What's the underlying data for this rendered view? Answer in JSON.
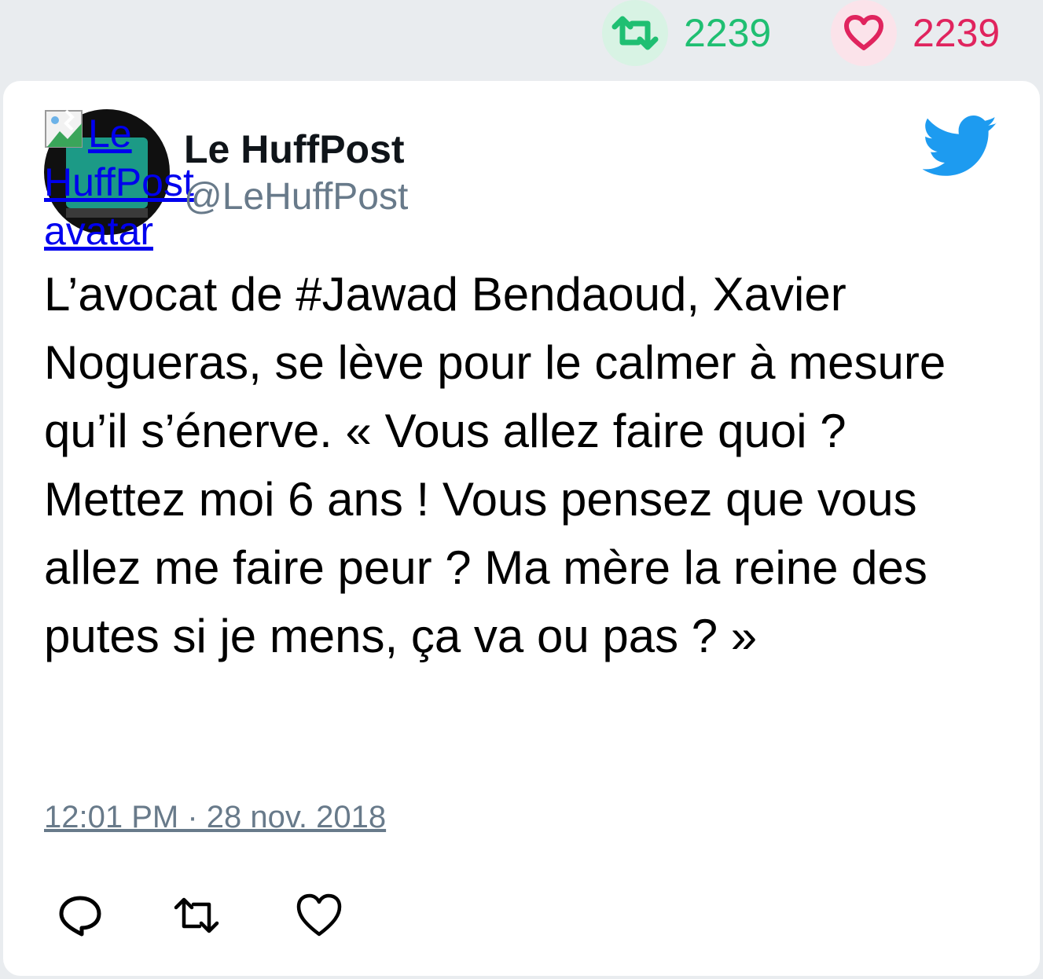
{
  "stats": {
    "retweet_count": "2239",
    "like_count": "2239"
  },
  "tweet": {
    "avatar_alt": "Le HuffPost avatar",
    "author_name": "Le HuffPost",
    "author_handle": "@LeHuffPost",
    "text": "L’avocat de #Jawad Bendaoud, Xavier Nogueras, se lève pour le calmer à mesure qu’il s’énerve. « Vous allez faire quoi ? Mettez moi 6 ans ! Vous pensez que vous allez me faire peur ? Ma mère la reine des putes si je mens, ça va ou pas ? »",
    "timestamp": "12:01 PM · 28 nov. 2018"
  },
  "icons": {
    "retweet": "retweet-icon",
    "like": "heart-icon",
    "reply": "reply-icon",
    "brand": "twitter-bird-icon",
    "broken_image": "broken-image-icon"
  },
  "colors": {
    "retweet": "#1fbf72",
    "like": "#e0245e",
    "brand": "#1d9bf0",
    "muted": "#687a8a"
  }
}
